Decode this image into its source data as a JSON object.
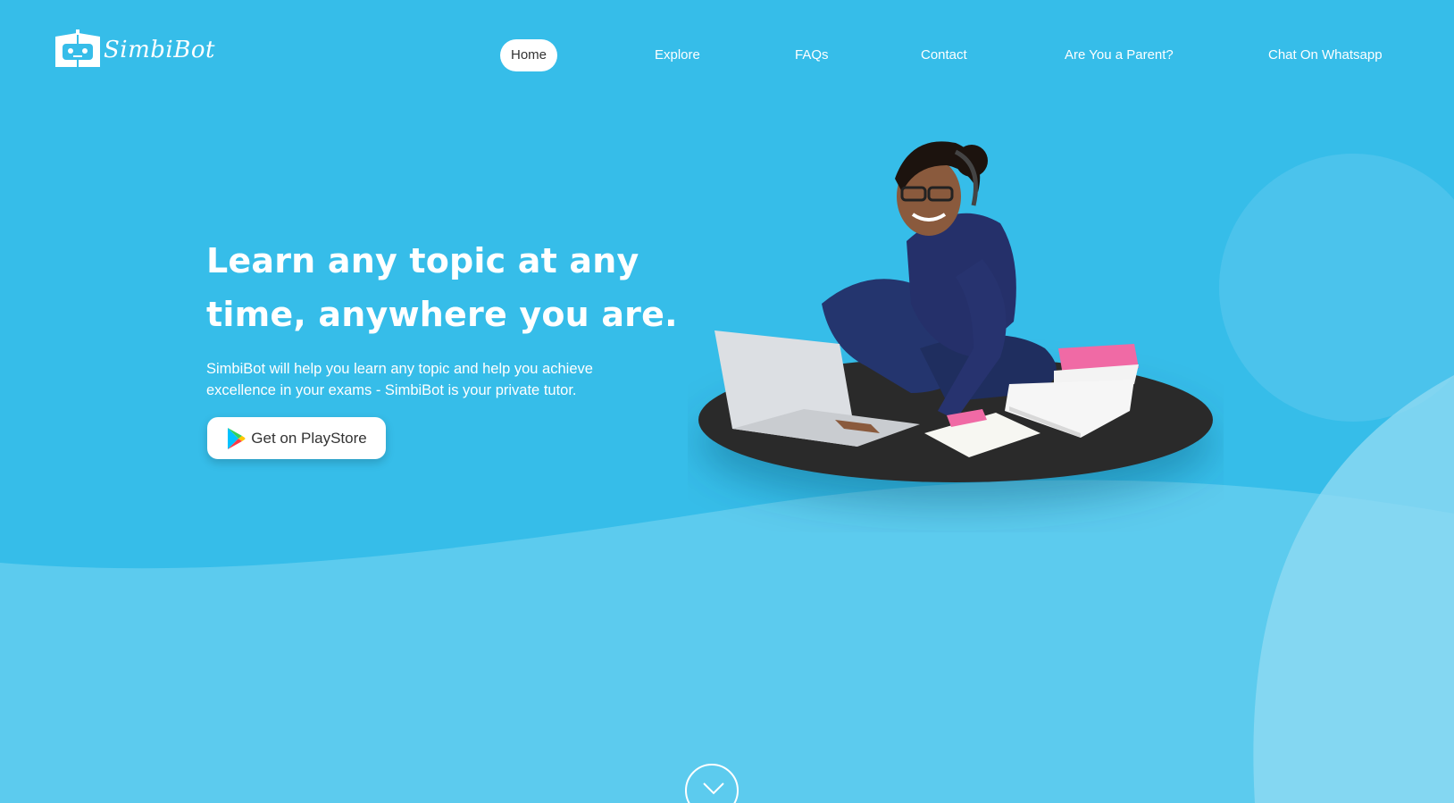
{
  "brand": {
    "name": "SimbiBot"
  },
  "nav": {
    "items": [
      {
        "label": "Home",
        "active": true
      },
      {
        "label": "Explore"
      },
      {
        "label": "FAQs"
      },
      {
        "label": "Contact"
      },
      {
        "label": "Are You a Parent?"
      },
      {
        "label": "Chat On Whatsapp"
      }
    ]
  },
  "hero": {
    "title_line1": "Learn any topic at any",
    "title_line2": "time, anywhere you are.",
    "subtitle_line1": "SimbiBot will help you learn any topic and help you achieve",
    "subtitle_line2": "excellence in your exams - SimbiBot is your private tutor.",
    "cta_label": "Get on PlayStore",
    "cta_icon": "google-play-icon"
  },
  "scroll": {
    "icon": "chevron-down-icon"
  },
  "colors": {
    "background": "#36bde9",
    "wave": "#5ccbee",
    "accent": "#ffffff"
  }
}
